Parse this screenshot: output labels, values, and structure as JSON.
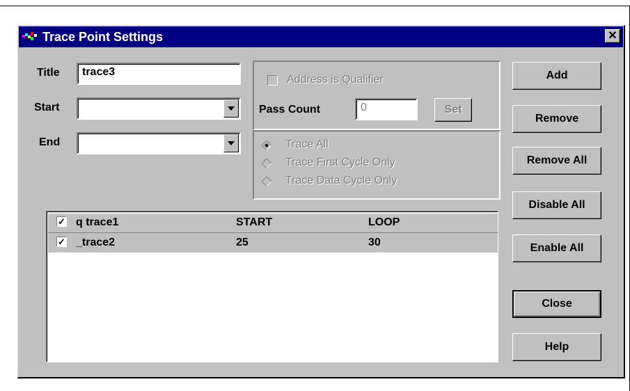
{
  "dialog": {
    "title": "Trace Point Settings",
    "close_label": "✕"
  },
  "form": {
    "title_label": "Title",
    "title_value": "trace3",
    "start_label": "Start",
    "start_value": "",
    "end_label": "End",
    "end_value": ""
  },
  "qualifier": {
    "address_is_qualifier_label": "Address is Qualifier",
    "address_is_qualifier_checked": false,
    "pass_count_label": "Pass Count",
    "pass_count_value": "0",
    "set_label": "Set"
  },
  "trace_mode": {
    "options": [
      {
        "label": "Trace All",
        "selected": true
      },
      {
        "label": "Trace First Cycle Only",
        "selected": false
      },
      {
        "label": "Trace Data Cycle Only",
        "selected": false
      }
    ]
  },
  "list": {
    "rows": [
      {
        "checked": true,
        "name": "q trace1",
        "start": "START",
        "end": "LOOP"
      },
      {
        "checked": true,
        "name": "_trace2",
        "start": "25",
        "end": "30"
      }
    ]
  },
  "buttons": {
    "add": "Add",
    "remove": "Remove",
    "remove_all": "Remove All",
    "disable_all": "Disable All",
    "enable_all": "Enable All",
    "close": "Close",
    "help": "Help"
  },
  "colors": {
    "titlebar": "#000080",
    "face": "#c0c0c0",
    "disabled_text": "#808080"
  }
}
